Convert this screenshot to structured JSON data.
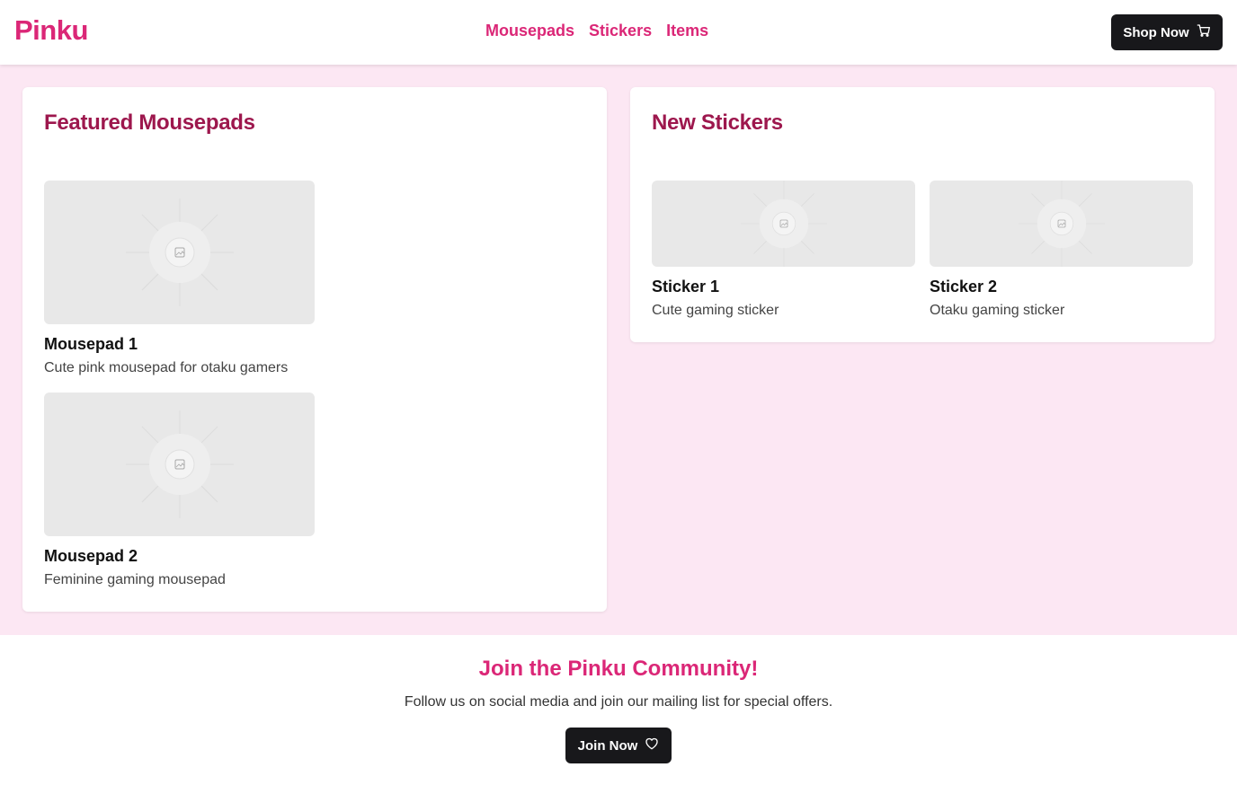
{
  "header": {
    "logo": "Pinku",
    "nav": [
      {
        "label": "Mousepads"
      },
      {
        "label": "Stickers"
      },
      {
        "label": "Items"
      }
    ],
    "shop_button": {
      "label": "Shop Now",
      "icon": "cart-icon"
    }
  },
  "featured": {
    "title": "Featured Mousepads",
    "items": [
      {
        "title": "Mousepad 1",
        "description": "Cute pink mousepad for otaku gamers",
        "image_icon": "image-placeholder-icon"
      },
      {
        "title": "Mousepad 2",
        "description": "Feminine gaming mousepad",
        "image_icon": "image-placeholder-icon"
      }
    ]
  },
  "stickers": {
    "title": "New Stickers",
    "items": [
      {
        "title": "Sticker 1",
        "description": "Cute gaming sticker",
        "image_icon": "image-placeholder-icon"
      },
      {
        "title": "Sticker 2",
        "description": "Otaku gaming sticker",
        "image_icon": "image-placeholder-icon"
      }
    ]
  },
  "footer": {
    "title": "Join the Pinku Community!",
    "text": "Follow us on social media and join our mailing list for special offers.",
    "join_button": {
      "label": "Join Now",
      "icon": "heart-icon"
    }
  },
  "colors": {
    "brand_pink": "#db2777",
    "heading_pink": "#9d174d",
    "page_background": "#fce7f3",
    "button_dark": "#18181b"
  }
}
